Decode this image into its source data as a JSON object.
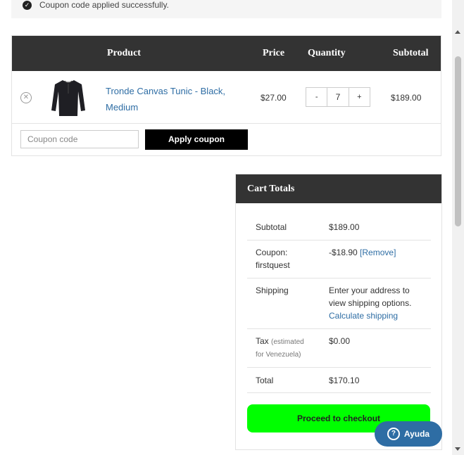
{
  "notice": {
    "text": "Coupon code applied successfully."
  },
  "cart": {
    "headers": {
      "product": "Product",
      "price": "Price",
      "quantity": "Quantity",
      "subtotal": "Subtotal"
    },
    "item": {
      "name_line1": "Tronde Canvas Tunic - Black,",
      "name_line2": "Medium",
      "price": "$27.00",
      "quantity": "7",
      "subtotal": "$189.00"
    },
    "qty_minus": "-",
    "qty_plus": "+",
    "coupon_placeholder": "Coupon code",
    "apply_label": "Apply coupon"
  },
  "totals": {
    "title": "Cart Totals",
    "subtotal_label": "Subtotal",
    "subtotal_value": "$189.00",
    "coupon_label_1": "Coupon:",
    "coupon_label_2": "firstquest",
    "coupon_value": "-$18.90",
    "coupon_remove": "[Remove]",
    "shipping_label": "Shipping",
    "shipping_text_1": "Enter your address to",
    "shipping_text_2": "view shipping options.",
    "shipping_link": "Calculate shipping",
    "tax_label": "Tax",
    "tax_note_1": "(estimated",
    "tax_note_2": "for Venezuela)",
    "tax_value": "$0.00",
    "total_label": "Total",
    "total_value": "$170.10",
    "checkout_label": "Proceed to checkout"
  },
  "help": {
    "label": "Ayuda"
  },
  "colors": {
    "header_bg": "#333333",
    "link": "#2e6da4",
    "checkout": "#00ff00",
    "apply_button": "#000000",
    "help_button": "#2e6da4"
  },
  "icons": {
    "notice": "check-circle-icon",
    "remove": "remove-circle-icon",
    "help": "question-circle-icon"
  }
}
